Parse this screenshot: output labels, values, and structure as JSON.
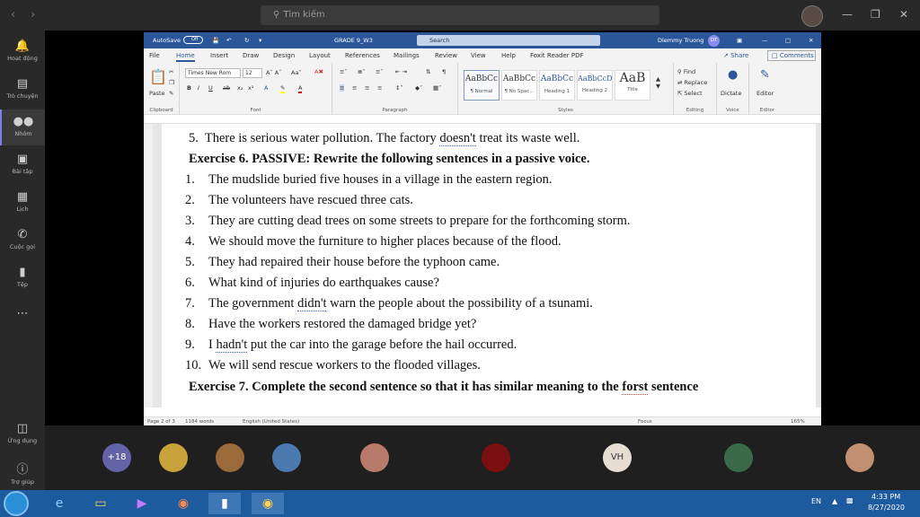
{
  "teams": {
    "search_placeholder": "Tìm kiếm",
    "rail": [
      {
        "label": "Hoạt động",
        "icon": "bell-icon"
      },
      {
        "label": "Trò chuyện",
        "icon": "chat-icon"
      },
      {
        "label": "Nhóm",
        "icon": "teams-icon"
      },
      {
        "label": "Bài tập",
        "icon": "assignments-icon"
      },
      {
        "label": "Lịch",
        "icon": "calendar-icon"
      },
      {
        "label": "Cuộc gọi",
        "icon": "phone-icon"
      },
      {
        "label": "Tệp",
        "icon": "file-icon"
      },
      {
        "label": "Ứng dụng",
        "icon": "apps-icon"
      },
      {
        "label": "Trợ giúp",
        "icon": "help-icon"
      }
    ],
    "participants": [
      {
        "initials": "+18",
        "color": "#6264a7"
      },
      {
        "initials": "",
        "color": "#c8a23a"
      },
      {
        "initials": "",
        "color": "#9a6a3a"
      },
      {
        "initials": "",
        "color": "#4a7ab0"
      },
      {
        "initials": "",
        "color": "#b87a6a"
      },
      {
        "initials": "",
        "color": "#7a1010"
      },
      {
        "initials": "VH",
        "color": "#e8ddd2"
      },
      {
        "initials": "",
        "color": "#3a6a4a"
      },
      {
        "initials": "",
        "color": "#c09070"
      }
    ]
  },
  "word": {
    "autosave": "AutoSave",
    "autosave_state": "Off",
    "doc_title": "GRADE 9_W3",
    "search": "Search",
    "user": "Diemmy Truong",
    "user_initials": "DT",
    "menu": [
      "File",
      "Home",
      "Insert",
      "Draw",
      "Design",
      "Layout",
      "References",
      "Mailings",
      "Review",
      "View",
      "Help",
      "Foxit Reader PDF"
    ],
    "share": "Share",
    "comments": "Comments",
    "ribbon": {
      "paste": "Paste",
      "font_name": "Times New Rom",
      "font_size": "12",
      "styles": [
        {
          "preview": "AaBbCc",
          "name": "¶ Normal"
        },
        {
          "preview": "AaBbCc",
          "name": "¶ No Spac..."
        },
        {
          "preview": "AaBbCc",
          "name": "Heading 1"
        },
        {
          "preview": "AaBbCcD",
          "name": "Heading 2"
        },
        {
          "preview": "AaB",
          "name": "Title"
        }
      ],
      "find": "Find",
      "replace": "Replace",
      "select": "Select",
      "dictate": "Dictate",
      "editor": "Editor",
      "groups": [
        "Clipboard",
        "Font",
        "Paragraph",
        "Styles",
        "Editing",
        "Voice",
        "Editor"
      ]
    },
    "status": {
      "page": "Page 2 of 3",
      "words": "1184 words",
      "language": "English (United States)",
      "focus": "Focus",
      "zoom": "165%"
    }
  },
  "document": {
    "line5_prev": {
      "num": "5.",
      "before": "There is serious water pollution. The factory ",
      "und": "doesn't",
      "after": " treat its waste well."
    },
    "ex6_heading": "Exercise 6. PASSIVE: Rewrite the following sentences in a passive voice.",
    "ex6_items": [
      {
        "num": "1.",
        "text": "The mudslide buried five houses in a village in the eastern region."
      },
      {
        "num": "2.",
        "text": "The volunteers have rescued three cats."
      },
      {
        "num": "3.",
        "text": "They are cutting dead trees on some streets to prepare for the forthcoming storm."
      },
      {
        "num": "4.",
        "text": "We should move the furniture to higher places because of the flood."
      },
      {
        "num": "5.",
        "text": "They had repaired their house before the typhoon came."
      },
      {
        "num": "6.",
        "text": "What kind of injuries do earthquakes cause?"
      },
      {
        "num": "7.",
        "before": "The government ",
        "und": "didn't",
        "after": " warn the people about the possibility of a tsunami."
      },
      {
        "num": "8.",
        "text": "Have the workers restored the damaged bridge yet?"
      },
      {
        "num": "9.",
        "before": "I ",
        "und": "hadn't",
        "after": " put the car into the garage before the hail occurred."
      },
      {
        "num": "10.",
        "text": "We will send rescue workers to the flooded villages."
      }
    ],
    "ex7_heading": {
      "before": "Exercise 7.  Complete the second sentence so that it has similar meaning to the ",
      "red": "forst",
      "after": " sentence"
    }
  },
  "taskbar": {
    "lang": "EN",
    "time": "4:33 PM",
    "date": "8/27/2020"
  }
}
